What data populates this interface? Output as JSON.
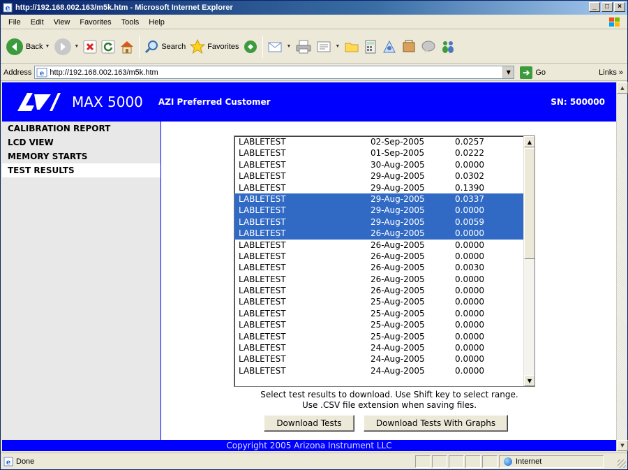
{
  "window": {
    "title": "http://192.168.002.163/m5k.htm - Microsoft Internet Explorer",
    "min": "_",
    "max": "□",
    "close": "×"
  },
  "menu": [
    "File",
    "Edit",
    "View",
    "Favorites",
    "Tools",
    "Help"
  ],
  "toolbar": {
    "back": "Back",
    "search": "Search",
    "favorites": "Favorites"
  },
  "address": {
    "label": "Address",
    "url": "http://192.168.002.163/m5k.htm",
    "go": "Go",
    "links": "Links »"
  },
  "header": {
    "product": "MAX 5000",
    "customer": "AZI Preferred Customer",
    "serial": "SN: 500000"
  },
  "nav": [
    "CALIBRATION REPORT",
    "LCD VIEW",
    "MEMORY STARTS",
    "TEST RESULTS"
  ],
  "tests": [
    [
      "LABLETEST",
      "02-Sep-2005",
      "0.0257",
      false
    ],
    [
      "LABLETEST",
      "01-Sep-2005",
      "0.0222",
      false
    ],
    [
      "LABLETEST",
      "30-Aug-2005",
      "0.0000",
      false
    ],
    [
      "LABLETEST",
      "29-Aug-2005",
      "0.0302",
      false
    ],
    [
      "LABLETEST",
      "29-Aug-2005",
      "0.1390",
      false
    ],
    [
      "LABLETEST",
      "29-Aug-2005",
      "0.0337",
      true
    ],
    [
      "LABLETEST",
      "29-Aug-2005",
      "0.0000",
      true
    ],
    [
      "LABLETEST",
      "29-Aug-2005",
      "0.0059",
      true
    ],
    [
      "LABLETEST",
      "26-Aug-2005",
      "0.0000",
      true
    ],
    [
      "LABLETEST",
      "26-Aug-2005",
      "0.0000",
      false
    ],
    [
      "LABLETEST",
      "26-Aug-2005",
      "0.0000",
      false
    ],
    [
      "LABLETEST",
      "26-Aug-2005",
      "0.0030",
      false
    ],
    [
      "LABLETEST",
      "26-Aug-2005",
      "0.0000",
      false
    ],
    [
      "LABLETEST",
      "26-Aug-2005",
      "0.0000",
      false
    ],
    [
      "LABLETEST",
      "25-Aug-2005",
      "0.0000",
      false
    ],
    [
      "LABLETEST",
      "25-Aug-2005",
      "0.0000",
      false
    ],
    [
      "LABLETEST",
      "25-Aug-2005",
      "0.0000",
      false
    ],
    [
      "LABLETEST",
      "25-Aug-2005",
      "0.0000",
      false
    ],
    [
      "LABLETEST",
      "24-Aug-2005",
      "0.0000",
      false
    ],
    [
      "LABLETEST",
      "24-Aug-2005",
      "0.0000",
      false
    ],
    [
      "LABLETEST",
      "24-Aug-2005",
      "0.0000",
      false
    ]
  ],
  "instructions": {
    "line1": "Select test results to download. Use Shift key to select range.",
    "line2": "Use .CSV file extension when saving files."
  },
  "buttons": {
    "download": "Download Tests",
    "download_graphs": "Download Tests With Graphs"
  },
  "footer": "Copyright 2005 Arizona Instrument LLC",
  "status": {
    "text": "Done",
    "zone": "Internet"
  },
  "colors": {
    "brand_blue": "#0000ff",
    "selection": "#316ac5"
  }
}
